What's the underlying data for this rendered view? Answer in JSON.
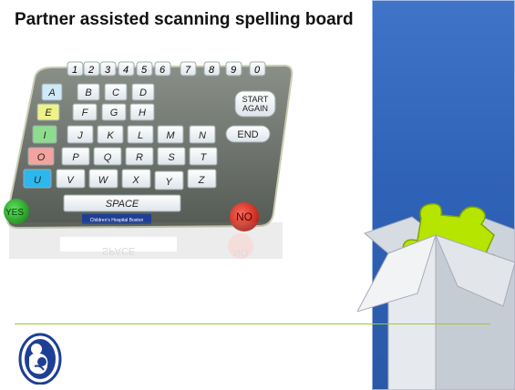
{
  "slide": {
    "title": "Partner assisted scanning spelling board"
  },
  "board": {
    "numbers": [
      "1",
      "2",
      "3",
      "4",
      "5",
      "6",
      "7",
      "8",
      "9",
      "0"
    ],
    "letter_rows": [
      [
        "A",
        "B",
        "C",
        "D"
      ],
      [
        "E",
        "F",
        "G",
        "H"
      ],
      [
        "I",
        "J",
        "K",
        "L",
        "M",
        "N"
      ],
      [
        "O",
        "P",
        "Q",
        "R",
        "S",
        "T"
      ],
      [
        "U",
        "V",
        "W",
        "X",
        "Y",
        "Z"
      ]
    ],
    "start_label_line1": "START",
    "start_label_line2": "AGAIN",
    "end_label": "END",
    "space_label": "SPACE",
    "yes_label": "YES",
    "no_label": "NO",
    "footer_label": "Children's Hospital Boston",
    "reflection_text_1": "SPACE",
    "reflection_text_2": "NO"
  },
  "colors": {
    "accent_line": "#9acd32",
    "panel_blue": "#2f63b8",
    "puzzle_green": "#b6e600"
  },
  "icons": {
    "logo": "hospital-mother-child-logo",
    "box": "open-box-with-puzzle-piece"
  }
}
